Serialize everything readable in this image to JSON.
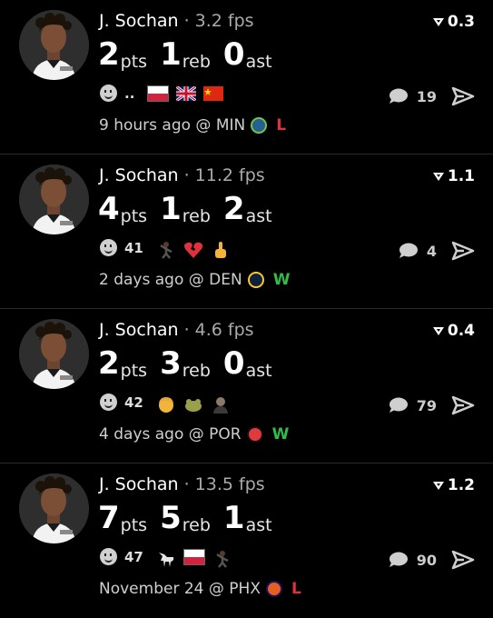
{
  "colors": {
    "background": "#000000",
    "win": "#2fbd4a",
    "loss": "#e0323c"
  },
  "posts": [
    {
      "player": "J. Sochan",
      "sep": " · ",
      "fps": "3.2 fps",
      "score": "0.3",
      "stats": [
        {
          "num": "2",
          "unit": "pts"
        },
        {
          "num": "1",
          "unit": "reb"
        },
        {
          "num": "0",
          "unit": "ast"
        }
      ],
      "react_count": "..",
      "react_emojis": [
        "poland-flag-icon",
        "uk-flag-icon",
        "china-flag-icon"
      ],
      "comments": "19",
      "time": "9 hours ago @ MIN",
      "team_icon": "timberwolves-logo-icon",
      "result": "L"
    },
    {
      "player": "J. Sochan",
      "sep": " · ",
      "fps": "11.2 fps",
      "score": "1.1",
      "stats": [
        {
          "num": "4",
          "unit": "pts"
        },
        {
          "num": "1",
          "unit": "reb"
        },
        {
          "num": "2",
          "unit": "ast"
        }
      ],
      "react_count": "41",
      "react_emojis": [
        "dancer-icon",
        "broken-heart-icon",
        "middle-finger-icon"
      ],
      "comments": "4",
      "time": "2 days ago @ DEN",
      "team_icon": "nuggets-logo-icon",
      "result": "W"
    },
    {
      "player": "J. Sochan",
      "sep": " · ",
      "fps": "4.6 fps",
      "score": "0.4",
      "stats": [
        {
          "num": "2",
          "unit": "pts"
        },
        {
          "num": "3",
          "unit": "reb"
        },
        {
          "num": "0",
          "unit": "ast"
        }
      ],
      "react_count": "42",
      "react_emojis": [
        "blond-person-icon",
        "frog-icon",
        "bald-man-icon"
      ],
      "comments": "79",
      "time": "4 days ago @ POR",
      "team_icon": "blazers-logo-icon",
      "result": "W"
    },
    {
      "player": "J. Sochan",
      "sep": " · ",
      "fps": "13.5 fps",
      "score": "1.2",
      "stats": [
        {
          "num": "7",
          "unit": "pts"
        },
        {
          "num": "5",
          "unit": "reb"
        },
        {
          "num": "1",
          "unit": "ast"
        }
      ],
      "react_count": "47",
      "react_emojis": [
        "goat-icon",
        "poland-flag-icon",
        "dancer-icon"
      ],
      "comments": "90",
      "time": "November 24 @ PHX",
      "team_icon": "suns-logo-icon",
      "result": "L"
    }
  ]
}
